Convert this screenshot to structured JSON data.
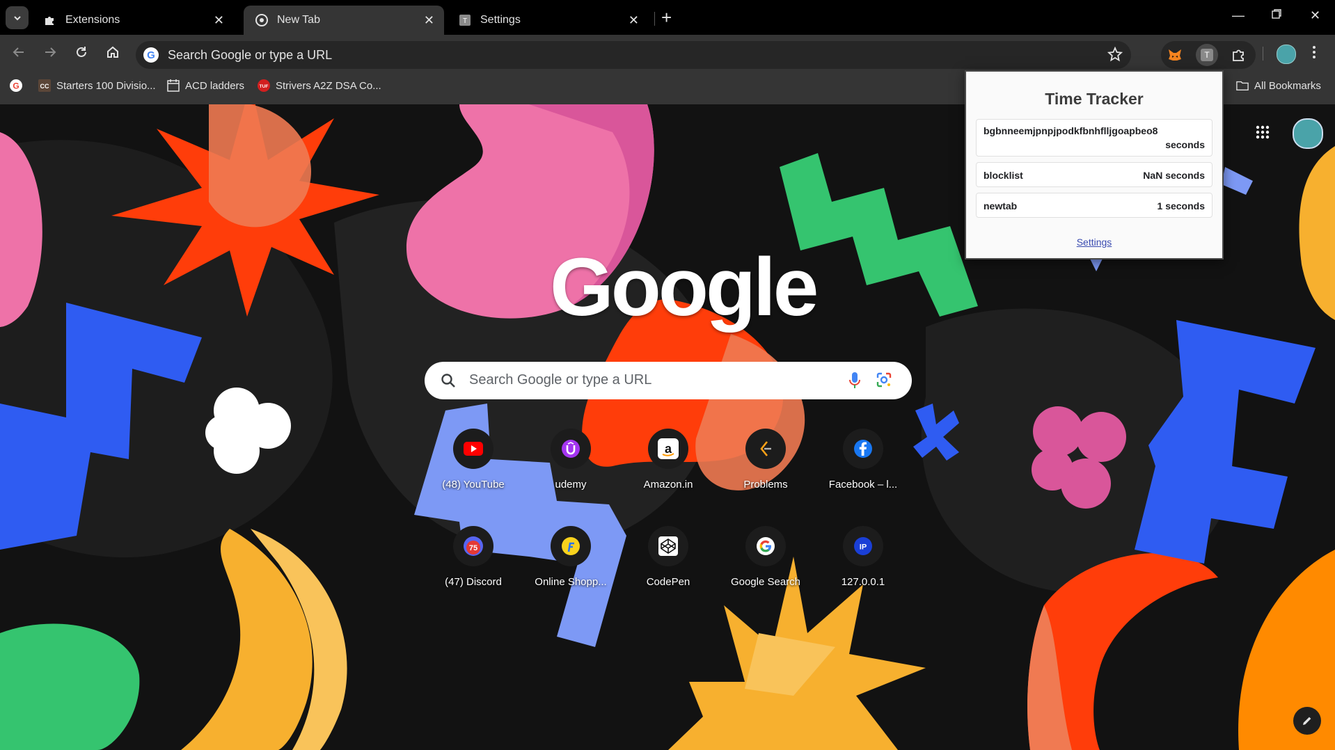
{
  "tabs": [
    {
      "title": "Extensions",
      "icon": "puzzle-icon",
      "active": false
    },
    {
      "title": "New Tab",
      "icon": "chrome-icon",
      "active": true
    },
    {
      "title": "Settings",
      "icon": "t-extension-icon",
      "active": false
    }
  ],
  "omnibox": {
    "placeholder": "Search Google or type a URL"
  },
  "toolbar": {
    "extension_letter": "T"
  },
  "bookmarks": {
    "items": [
      {
        "label": "Starters 100 Divisio...",
        "icon": "codechef-icon"
      },
      {
        "label": "ACD ladders",
        "icon": "calendar-icon"
      },
      {
        "label": "Strivers A2Z DSA Co...",
        "icon": "tuf-icon"
      }
    ],
    "all_bookmarks": "All Bookmarks"
  },
  "ntp": {
    "logo": "Google",
    "search_placeholder": "Search Google or type a URL",
    "shortcuts": [
      {
        "label": "(48) YouTube",
        "icon": "youtube-icon"
      },
      {
        "label": "udemy",
        "icon": "udemy-icon"
      },
      {
        "label": "Amazon.in",
        "icon": "amazon-icon"
      },
      {
        "label": "Problems",
        "icon": "problems-icon"
      },
      {
        "label": "Facebook – l...",
        "icon": "facebook-icon"
      },
      {
        "label": "(47) Discord",
        "icon": "discord-icon"
      },
      {
        "label": "Online Shopp...",
        "icon": "flipkart-icon"
      },
      {
        "label": "CodePen",
        "icon": "codepen-icon"
      },
      {
        "label": "Google Search",
        "icon": "google-icon"
      },
      {
        "label": "127.0.0.1",
        "icon": "ip-icon"
      }
    ]
  },
  "popup": {
    "title": "Time Tracker",
    "rows": [
      {
        "site": "bgbnneemjpnpjpodkfbnhflljgoapbeo8",
        "time": "seconds"
      },
      {
        "site": "blocklist",
        "time": "NaN seconds"
      },
      {
        "site": "newtab",
        "time": "1 seconds"
      }
    ],
    "settings_link": "Settings"
  },
  "colors": {
    "chrome_bg": "#353535",
    "accent_red": "#ff3d0a",
    "accent_pink": "#ee72a8",
    "accent_green": "#35c46f",
    "accent_blue": "#2f5cf2",
    "accent_yellow": "#f7b02f",
    "accent_periwinkle": "#7d99f5"
  }
}
